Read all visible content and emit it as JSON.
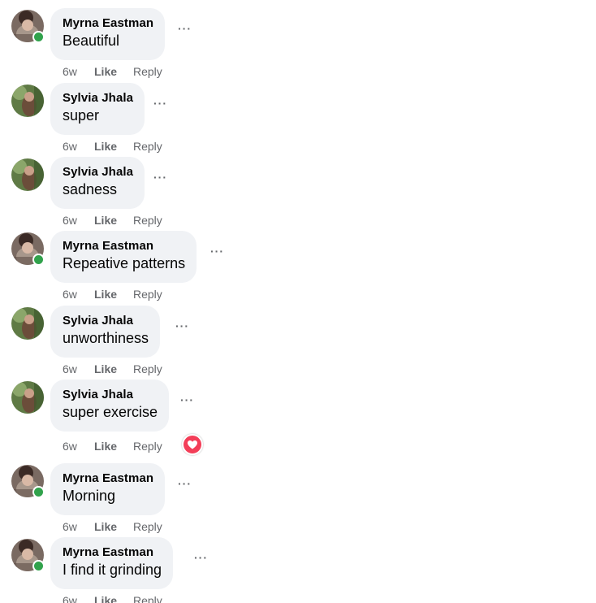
{
  "comments": [
    {
      "author": "Myrna Eastman",
      "text": "Beautiful",
      "time": "6w",
      "like": "Like",
      "reply": "Reply",
      "more": "···",
      "online": true
    },
    {
      "author": "Sylvia Jhala",
      "text": "super",
      "time": "6w",
      "like": "Like",
      "reply": "Reply",
      "more": "···",
      "online": false
    },
    {
      "author": "Sylvia Jhala",
      "text": "sadness",
      "time": "6w",
      "like": "Like",
      "reply": "Reply",
      "more": "···",
      "online": false
    },
    {
      "author": "Myrna Eastman",
      "text": "Repeative patterns",
      "time": "6w",
      "like": "Like",
      "reply": "Reply",
      "more": "···",
      "online": true
    },
    {
      "author": "Sylvia Jhala",
      "text": "unworthiness",
      "time": "6w",
      "like": "Like",
      "reply": "Reply",
      "more": "···",
      "online": false
    },
    {
      "author": "Sylvia Jhala",
      "text": "super exercise",
      "time": "6w",
      "like": "Like",
      "reply": "Reply",
      "more": "···",
      "online": false,
      "reaction": "love-icon"
    },
    {
      "author": "Myrna Eastman",
      "text": "Morning",
      "time": "6w",
      "like": "Like",
      "reply": "Reply",
      "more": "···",
      "online": true
    },
    {
      "author": "Myrna Eastman",
      "text": "I find it grinding",
      "time": "6w",
      "like": "Like",
      "reply": "Reply",
      "more": "···",
      "online": true
    }
  ],
  "colors": {
    "bubble": "#f0f2f5",
    "meta_text": "#65676b",
    "online": "#31a24c",
    "love_reaction": "#f33e58"
  }
}
